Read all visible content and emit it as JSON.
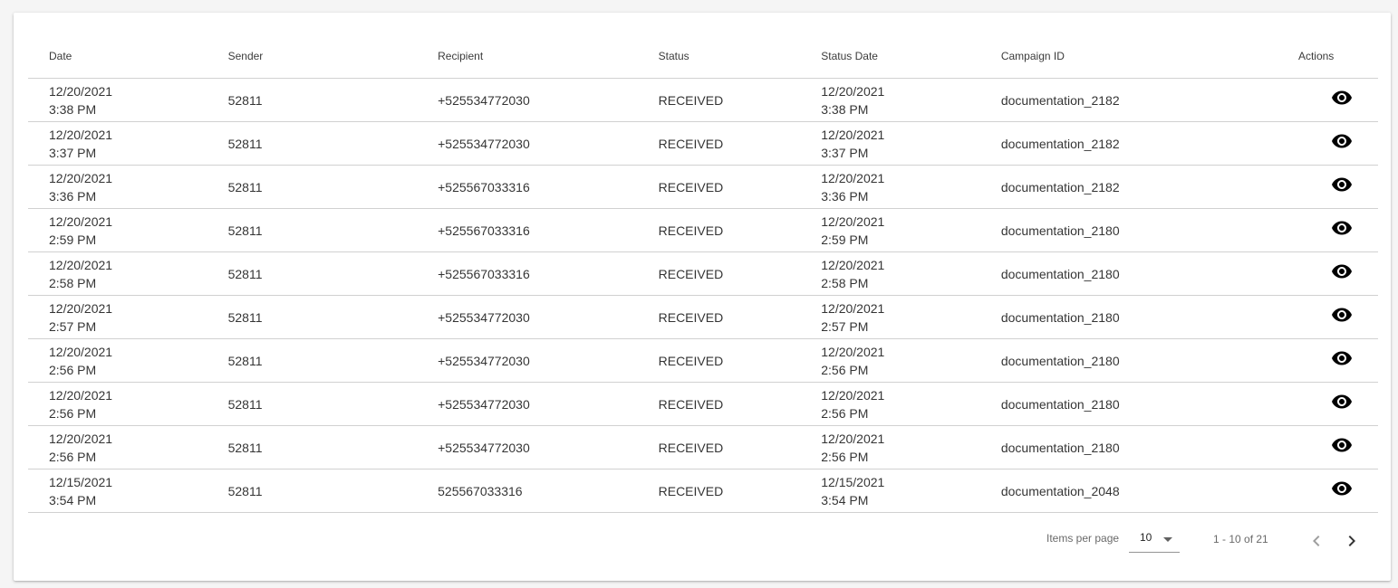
{
  "table": {
    "columns": [
      "Date",
      "Sender",
      "Recipient",
      "Status",
      "Status Date",
      "Campaign ID",
      "Actions"
    ],
    "rows": [
      {
        "date": "12/20/2021",
        "time": "3:38 PM",
        "sender": "52811",
        "recipient": "+525534772030",
        "status": "RECEIVED",
        "status_date": "12/20/2021",
        "status_time": "3:38 PM",
        "campaign": "documentation_2182"
      },
      {
        "date": "12/20/2021",
        "time": "3:37 PM",
        "sender": "52811",
        "recipient": "+525534772030",
        "status": "RECEIVED",
        "status_date": "12/20/2021",
        "status_time": "3:37 PM",
        "campaign": "documentation_2182"
      },
      {
        "date": "12/20/2021",
        "time": "3:36 PM",
        "sender": "52811",
        "recipient": "+525567033316",
        "status": "RECEIVED",
        "status_date": "12/20/2021",
        "status_time": "3:36 PM",
        "campaign": "documentation_2182"
      },
      {
        "date": "12/20/2021",
        "time": "2:59 PM",
        "sender": "52811",
        "recipient": "+525567033316",
        "status": "RECEIVED",
        "status_date": "12/20/2021",
        "status_time": "2:59 PM",
        "campaign": "documentation_2180"
      },
      {
        "date": "12/20/2021",
        "time": "2:58 PM",
        "sender": "52811",
        "recipient": "+525567033316",
        "status": "RECEIVED",
        "status_date": "12/20/2021",
        "status_time": "2:58 PM",
        "campaign": "documentation_2180"
      },
      {
        "date": "12/20/2021",
        "time": "2:57 PM",
        "sender": "52811",
        "recipient": "+525534772030",
        "status": "RECEIVED",
        "status_date": "12/20/2021",
        "status_time": "2:57 PM",
        "campaign": "documentation_2180"
      },
      {
        "date": "12/20/2021",
        "time": "2:56 PM",
        "sender": "52811",
        "recipient": "+525534772030",
        "status": "RECEIVED",
        "status_date": "12/20/2021",
        "status_time": "2:56 PM",
        "campaign": "documentation_2180"
      },
      {
        "date": "12/20/2021",
        "time": "2:56 PM",
        "sender": "52811",
        "recipient": "+525534772030",
        "status": "RECEIVED",
        "status_date": "12/20/2021",
        "status_time": "2:56 PM",
        "campaign": "documentation_2180"
      },
      {
        "date": "12/20/2021",
        "time": "2:56 PM",
        "sender": "52811",
        "recipient": "+525534772030",
        "status": "RECEIVED",
        "status_date": "12/20/2021",
        "status_time": "2:56 PM",
        "campaign": "documentation_2180"
      },
      {
        "date": "12/15/2021",
        "time": "3:54 PM",
        "sender": "52811",
        "recipient": "525567033316",
        "status": "RECEIVED",
        "status_date": "12/15/2021",
        "status_time": "3:54 PM",
        "campaign": "documentation_2048"
      }
    ],
    "row_action_icon": "eye-icon"
  },
  "paginator": {
    "items_per_page_label": "Items per page",
    "items_per_page_value": "10",
    "range_label": "1 - 10 of 21",
    "prev_icon": "chevron-left-icon",
    "next_icon": "chevron-right-icon"
  }
}
